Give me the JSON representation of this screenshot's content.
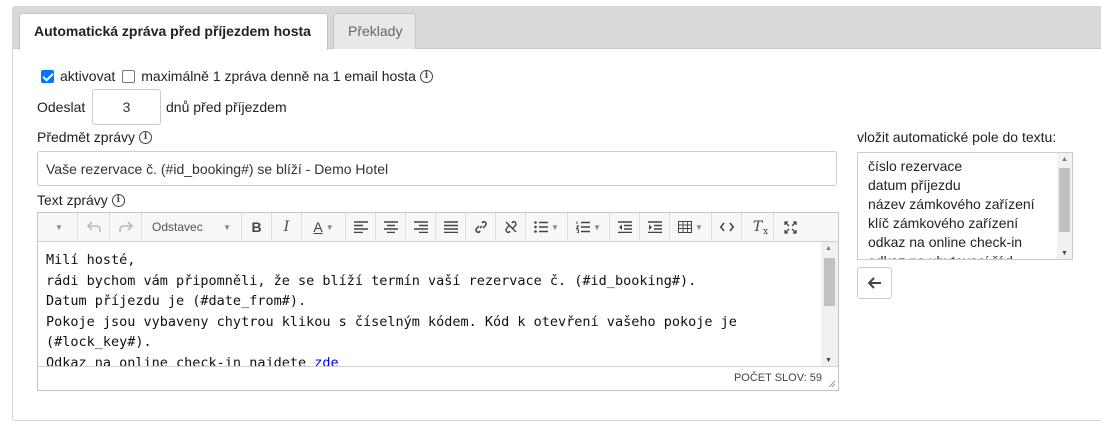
{
  "tabs": [
    {
      "label": "Automatická zpráva před příjezdem hosta",
      "active": true
    },
    {
      "label": "Překlady",
      "active": false
    }
  ],
  "options": {
    "activate_label": "aktivovat",
    "activate_checked": true,
    "max_one_label": "maximálně 1 zpráva denně na 1 email hosta",
    "max_one_checked": false
  },
  "send": {
    "label": "Odeslat",
    "days_value": "3",
    "suffix": "dnů před příjezdem"
  },
  "subject": {
    "label": "Předmět zprávy",
    "value": "Vaše rezervace č. (#id_booking#) se blíží - Demo Hotel"
  },
  "text": {
    "label": "Text zprávy"
  },
  "editor": {
    "format_label": "Odstavec",
    "lines": [
      "Milí hosté,",
      "rádi bychom vám připomněli, že se blíží termín vaší rezervace č. (#id_booking#).",
      "Datum příjezdu je (#date_from#).",
      "Pokoje jsou vybaveny chytrou klikou s číselným kódem. Kód k otevření vašeho pokoje je (#lock_key#).",
      "Odkaz na online check-in najdete "
    ],
    "link_text": "zde",
    "word_count": "POČET SLOV: 59"
  },
  "auto_fields": {
    "label": "vložit automatické pole do textu:",
    "items": [
      "číslo rezervace",
      "datum příjezdu",
      "název zámkového zařízení",
      "klíč zámkového zařízení",
      "odkaz na online check-in",
      "odkaz na ubytovací řád"
    ]
  },
  "colors": {
    "checkbox_accent": "#0075ff",
    "link": "#0000ee",
    "tabbar_bg": "#d9d9d9"
  }
}
